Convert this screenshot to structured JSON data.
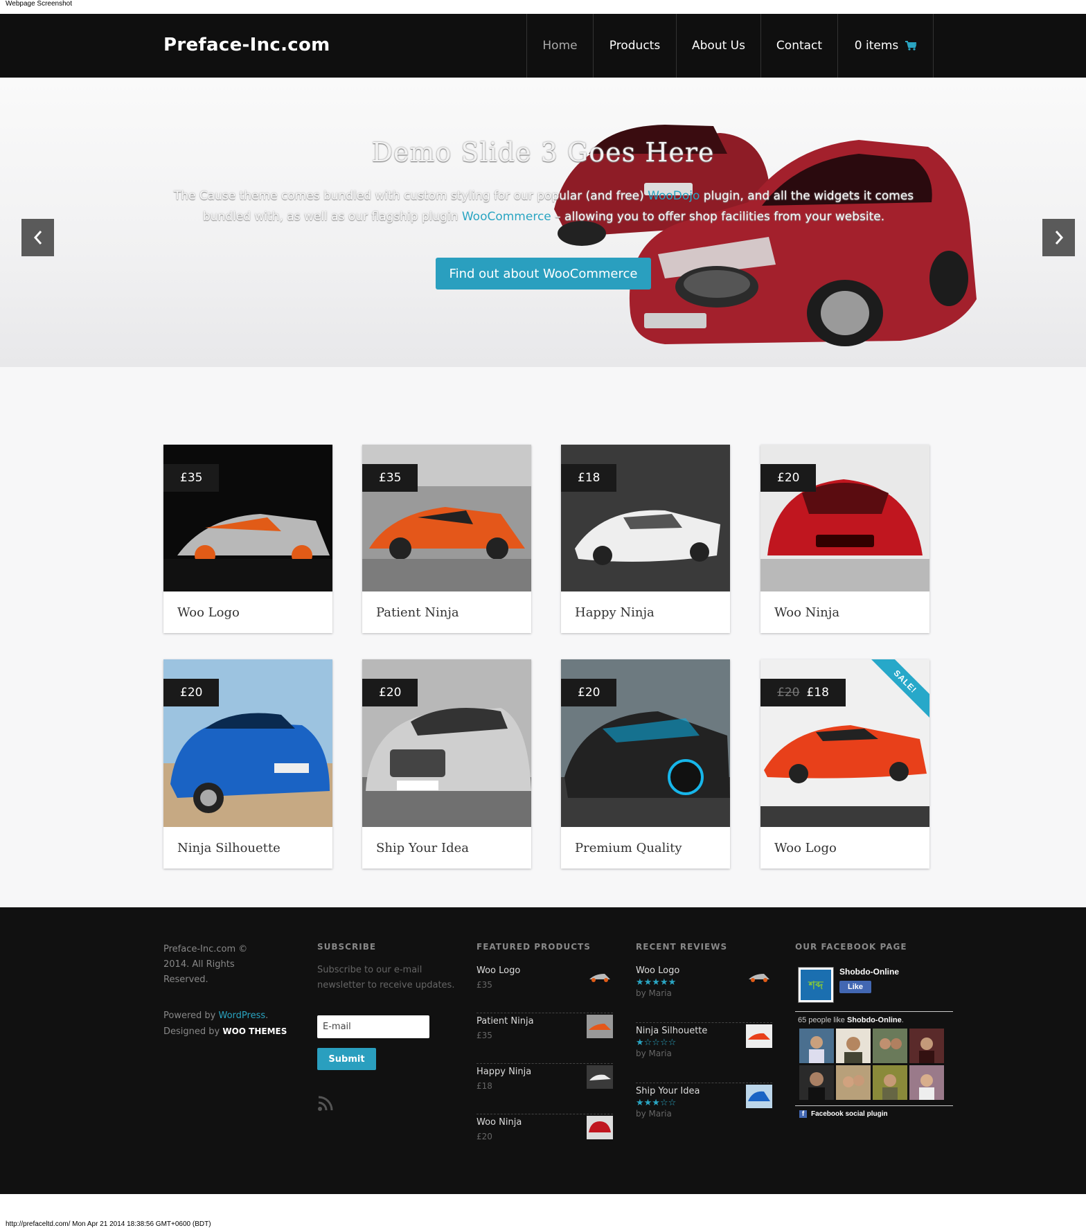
{
  "browser_caption": "Webpage Screenshot",
  "footer_caption": "http://prefaceltd.com/ Mon Apr 21 2014 18:38:56 GMT+0600 (BDT)",
  "site": {
    "logo": "Preface-Inc.com"
  },
  "nav": {
    "home": "Home",
    "products": "Products",
    "about": "About Us",
    "contact": "Contact",
    "cart": "0 items",
    "cart_icon": "cart-icon"
  },
  "hero": {
    "title": "Demo Slide 3 Goes Here",
    "text_1": "The Cause theme comes bundled with custom styling for our popular (and free) ",
    "link_1": "WooDojo",
    "text_2": " plugin, and all the widgets it comes bundled with, as well as our flagship plugin ",
    "link_2": "WooCommerce",
    "text_3": " – allowing you to offer shop facilities from your website.",
    "button": "Find out about WooCommerce",
    "prev_icon": "chevron-left-icon",
    "next_icon": "chevron-right-icon"
  },
  "products": [
    {
      "name": "Woo Logo",
      "price": "£35",
      "old_price": "",
      "sale": false
    },
    {
      "name": "Patient Ninja",
      "price": "£35",
      "old_price": "",
      "sale": false
    },
    {
      "name": "Happy Ninja",
      "price": "£18",
      "old_price": "",
      "sale": false
    },
    {
      "name": "Woo Ninja",
      "price": "£20",
      "old_price": "",
      "sale": false
    },
    {
      "name": "Ninja Silhouette",
      "price": "£20",
      "old_price": "",
      "sale": false
    },
    {
      "name": "Ship Your Idea",
      "price": "£20",
      "old_price": "",
      "sale": false
    },
    {
      "name": "Premium Quality",
      "price": "£20",
      "old_price": "",
      "sale": false
    },
    {
      "name": "Woo Logo",
      "price": "£18",
      "old_price": "£20",
      "sale": true,
      "sale_label": "SALE!"
    }
  ],
  "footer": {
    "copyright": "Preface-Inc.com © 2014. All Rights Reserved.",
    "powered_prefix": "Powered by ",
    "powered_link": "WordPress",
    "powered_suffix": ".",
    "designed_by": "Designed by ",
    "designer_logo": "WOO THEMES",
    "subscribe": {
      "heading": "SUBSCRIBE",
      "text": "Subscribe to our e-mail newsletter to receive updates.",
      "email_placeholder": "E-mail",
      "submit": "Submit",
      "rss_icon": "rss-icon"
    },
    "featured": {
      "heading": "FEATURED PRODUCTS",
      "items": [
        {
          "name": "Woo Logo",
          "price": "£35"
        },
        {
          "name": "Patient Ninja",
          "price": "£35"
        },
        {
          "name": "Happy Ninja",
          "price": "£18"
        },
        {
          "name": "Woo Ninja",
          "price": "£20"
        }
      ]
    },
    "reviews": {
      "heading": "RECENT REVIEWS",
      "items": [
        {
          "name": "Woo Logo",
          "rating": 5,
          "by": "by Maria"
        },
        {
          "name": "Ninja Silhouette",
          "rating": 1,
          "by": "by Maria"
        },
        {
          "name": "Ship Your Idea",
          "rating": 3,
          "by": "by Maria"
        }
      ]
    },
    "facebook": {
      "heading": "OUR FACEBOOK PAGE",
      "page_name": "Shobdo-Online",
      "like": "Like",
      "count_prefix": "65 people like ",
      "count_page": "Shobdo-Online",
      "count_suffix": ".",
      "plugin": "Facebook social plugin"
    }
  },
  "colors": {
    "accent": "#2a9fbf",
    "header_bg": "#0f0f0f",
    "footer_bg": "#111111"
  }
}
